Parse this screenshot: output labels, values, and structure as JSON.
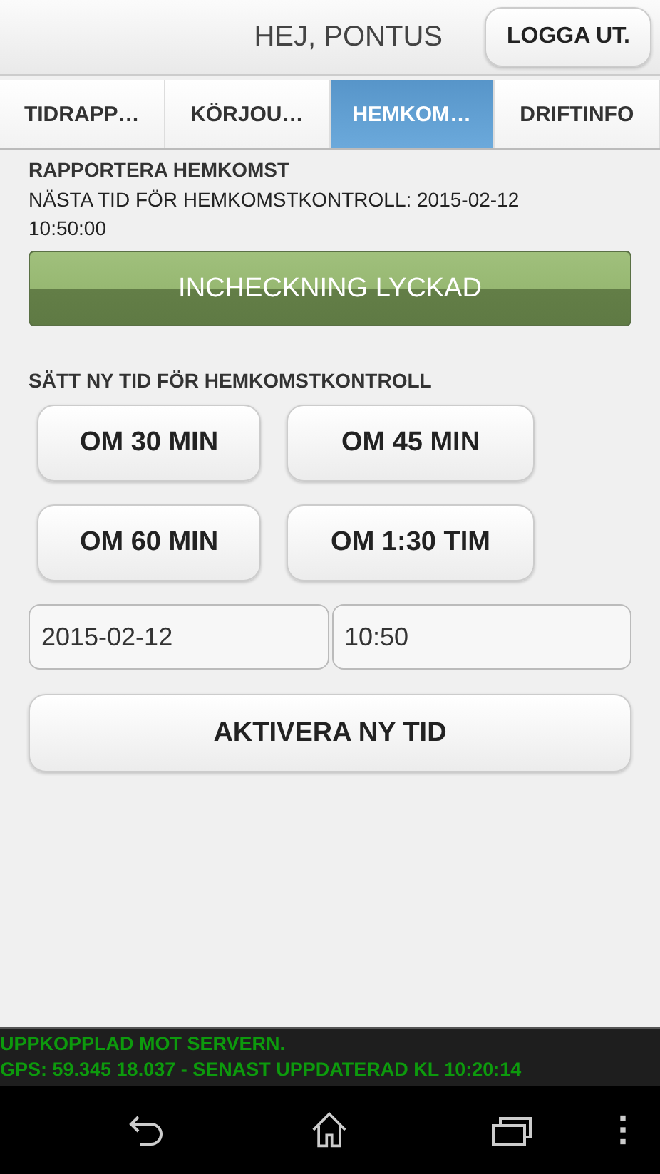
{
  "header": {
    "greeting": "HEJ, PONTUS",
    "logout_button": "LOGGA UT."
  },
  "tabs": [
    {
      "label": "TIDRAPP…",
      "selected": false
    },
    {
      "label": "KÖRJOU…",
      "selected": false
    },
    {
      "label": "HEMKOM…",
      "selected": true
    },
    {
      "label": "DRIFTINFO",
      "selected": false
    }
  ],
  "report": {
    "title": "RAPPORTERA HEMKOMST",
    "next_time": "NÄSTA TID FÖR HEMKOMSTKONTROLL: 2015-02-12 10:50:00",
    "status_banner": "INCHECKNING LYCKAD"
  },
  "new_time": {
    "title": "SÄTT NY TID FÖR HEMKOMSTKONTROLL",
    "quick_buttons": [
      "OM 30 MIN",
      "OM 45 MIN",
      "OM 60 MIN",
      "OM 1:30 TIM"
    ],
    "date_value": "2015-02-12",
    "time_value": "10:50",
    "activate_button": "AKTIVERA NY TID"
  },
  "status_bar": {
    "connection": "UPPKOPPLAD MOT SERVERN.",
    "gps": "GPS: 59.345 18.037 - SENAST UPPDATERAD KL 10:20:14"
  }
}
